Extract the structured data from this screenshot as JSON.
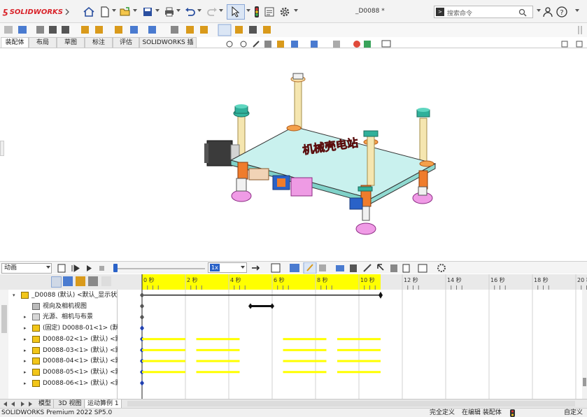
{
  "app": {
    "brand": "SOLIDWORKS",
    "document_title": "_D0088 *"
  },
  "search": {
    "placeholder": "搜索命令"
  },
  "tabs": [
    {
      "label": "装配体",
      "active": true
    },
    {
      "label": "布局",
      "active": false
    },
    {
      "label": "草图",
      "active": false
    },
    {
      "label": "标注",
      "active": false
    },
    {
      "label": "评估",
      "active": false
    },
    {
      "label": "SOLIDWORKS 插件",
      "active": false
    }
  ],
  "model": {
    "label_text": "机械壳电站"
  },
  "motion": {
    "study_type": "动画",
    "speed": "1x",
    "tree": [
      {
        "label": "_D0088 (默认) <默认_显示状态",
        "level": 0,
        "expander": "minus",
        "type": "assembly"
      },
      {
        "label": "视向及相机视图",
        "level": 1,
        "expander": "",
        "type": "camera"
      },
      {
        "label": "光源、相机与布景",
        "level": 1,
        "expander": "plus",
        "type": "folder"
      },
      {
        "label": "(固定) D0088-01<1> (默认",
        "level": 1,
        "expander": "plus",
        "type": "part"
      },
      {
        "label": "D0088-02<1> (默认) <默",
        "level": 1,
        "expander": "plus",
        "type": "part"
      },
      {
        "label": "D0088-03<1> (默认) <默",
        "level": 1,
        "expander": "plus",
        "type": "part"
      },
      {
        "label": "D0088-04<1> (默认) <默",
        "level": 1,
        "expander": "plus",
        "type": "part"
      },
      {
        "label": "D0088-05<1> (默认) <默",
        "level": 1,
        "expander": "plus",
        "type": "part"
      },
      {
        "label": "D0088-06<1> (默认) <默",
        "level": 1,
        "expander": "plus",
        "type": "part"
      }
    ],
    "timeline": {
      "ticks": [
        "0 秒",
        "2 秒",
        "4 秒",
        "6 秒",
        "8 秒",
        "10 秒",
        "12 秒",
        "14 秒",
        "16 秒",
        "18 秒",
        "20 秒"
      ],
      "tick_seconds": [
        0,
        2,
        4,
        6,
        8,
        10,
        12,
        14,
        16,
        18,
        20
      ],
      "study_length_s": 11,
      "camera_key_range_s": [
        5,
        6
      ],
      "yellow_bars_s": [
        [
          0,
          2
        ],
        [
          2.5,
          4.5
        ],
        [
          6.5,
          8.5
        ],
        [
          9,
          11
        ]
      ],
      "bar_rows": [
        4,
        5,
        6,
        7
      ]
    }
  },
  "bottom_tabs": [
    {
      "label": "模型",
      "active": false
    },
    {
      "label": "3D 视图",
      "active": false
    },
    {
      "label": "运动算例 1",
      "active": true
    }
  ],
  "status": {
    "product": "SOLIDWORKS Premium 2022 SP5.0",
    "definition": "完全定义",
    "mode": "在编辑 装配体",
    "custom": "自定义"
  },
  "colors": {
    "timeline_yellow": "#ffff00",
    "key_blue": "#1f3fb0",
    "accent": "#2a62c8"
  }
}
